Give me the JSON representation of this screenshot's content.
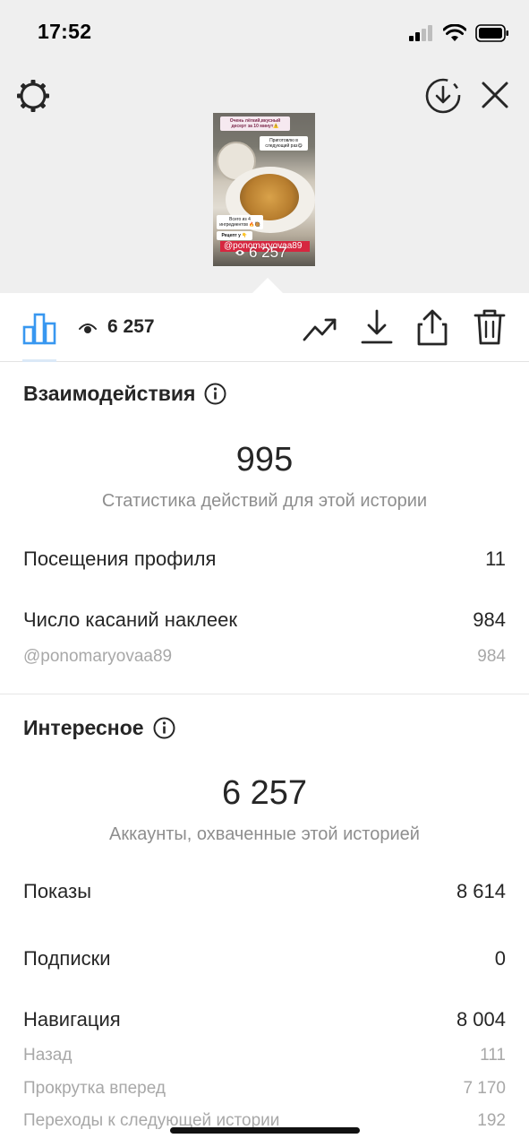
{
  "status_bar": {
    "time": "17:52"
  },
  "preview": {
    "caption_top": "Очень лёгкий,вкусный десерт за 10 минут⚠️",
    "caption_right": "Приготовлю в следующий раз😋",
    "caption_bottom": "Всего из 4 ингредиентов 🔥🥘",
    "caption_recipe": "Рецепт у 👇",
    "mention": "@ponomaryovaa89",
    "views": "6 257"
  },
  "toolbar": {
    "views_count": "6 257"
  },
  "interactions": {
    "title": "Взаимодействия",
    "total": "995",
    "caption": "Статистика действий для этой истории",
    "rows": [
      {
        "label": "Посещения профиля",
        "value": "11"
      },
      {
        "label": "Число касаний наклеек",
        "value": "984"
      }
    ],
    "sub_rows": [
      {
        "label": "@ponomaryovaa89",
        "value": "984"
      }
    ]
  },
  "discovery": {
    "title": "Интересное",
    "total": "6 257",
    "caption": "Аккаунты, охваченные этой историей",
    "rows": [
      {
        "label": "Показы",
        "value": "8 614"
      },
      {
        "label": "Подписки",
        "value": "0"
      },
      {
        "label": "Навигация",
        "value": "8 004"
      }
    ],
    "sub_rows": [
      {
        "label": "Назад",
        "value": "111"
      },
      {
        "label": "Прокрутка вперед",
        "value": "7 170"
      },
      {
        "label": "Переходы к следующей истории",
        "value": "192"
      }
    ]
  },
  "colors": {
    "accent_blue": "#3897f0",
    "text_primary": "#262626",
    "text_secondary": "#8e8e8e",
    "top_background": "#efefef",
    "mention_red": "#d6273f"
  }
}
